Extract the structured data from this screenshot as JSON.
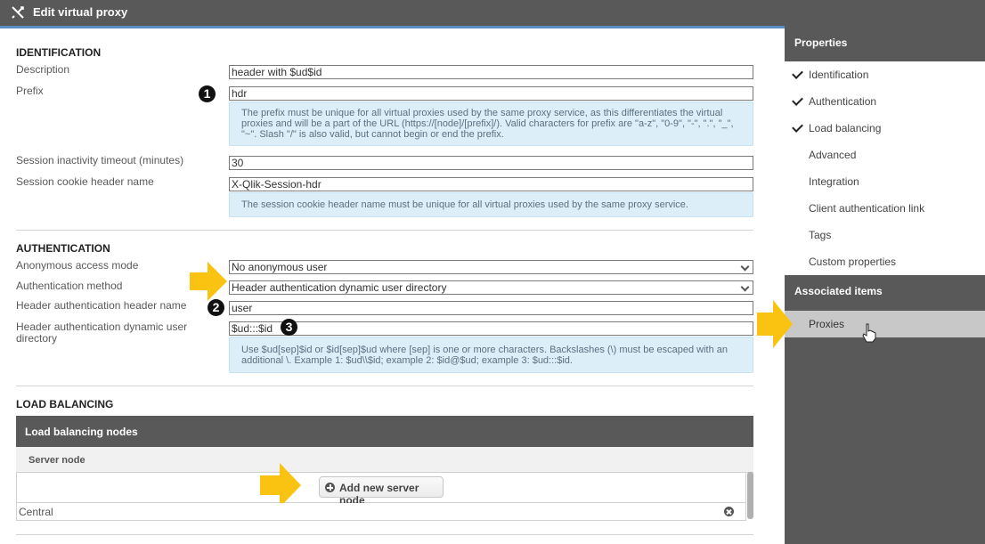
{
  "header": {
    "title": "Edit virtual proxy",
    "icon": "tools-icon"
  },
  "identification": {
    "title": "IDENTIFICATION",
    "description": {
      "label": "Description",
      "value": "header with $ud$id"
    },
    "prefix": {
      "label": "Prefix",
      "value": "hdr",
      "badge": "1",
      "help": "The prefix must be unique for all virtual proxies used by the same proxy service, as this differentiates the virtual proxies and will be a part of the URL (https://[node]/[prefix]/). Valid characters for prefix are \"a-z\", \"0-9\", \"-\", \".\", \"_\", \"~\". Slash \"/\" is also valid, but cannot begin or end the prefix."
    },
    "timeout": {
      "label": "Session inactivity timeout (minutes)",
      "value": "30"
    },
    "cookie": {
      "label": "Session cookie header name",
      "value": "X-Qlik-Session-hdr",
      "help": "The session cookie header name must be unique for all virtual proxies used by the same proxy service."
    }
  },
  "authentication": {
    "title": "AUTHENTICATION",
    "anonymous": {
      "label": "Anonymous access mode",
      "value": "No anonymous user"
    },
    "method": {
      "label": "Authentication method",
      "value": "Header authentication dynamic user directory"
    },
    "header_name": {
      "label": "Header authentication header name",
      "value": "user",
      "badge": "2"
    },
    "dynamic_dir": {
      "label": "Header authentication dynamic user directory",
      "value": "$ud:::$id",
      "badge": "3",
      "help": "Use $ud[sep]$id or $id[sep]$ud where [sep] is one or more characters. Backslashes (\\) must be escaped with an additional \\. Example 1: $ud\\\\$id; example 2: $id@$ud; example 3: $ud:::$id."
    }
  },
  "load_balancing": {
    "title": "LOAD BALANCING",
    "panel_title": "Load balancing nodes",
    "column": "Server node",
    "add_button": "Add new server node",
    "rows": [
      "Central"
    ]
  },
  "sidebar": {
    "properties_title": "Properties",
    "items": [
      {
        "label": "Identification",
        "checked": true
      },
      {
        "label": "Authentication",
        "checked": true
      },
      {
        "label": "Load balancing",
        "checked": true
      },
      {
        "label": "Advanced",
        "checked": false
      },
      {
        "label": "Integration",
        "checked": false
      },
      {
        "label": "Client authentication link",
        "checked": false
      },
      {
        "label": "Tags",
        "checked": false
      },
      {
        "label": "Custom properties",
        "checked": false
      }
    ],
    "associated_title": "Associated items",
    "associated_items": [
      {
        "label": "Proxies",
        "selected": true
      }
    ]
  },
  "colors": {
    "accent": "#5b8ec4",
    "header_bg": "#595959",
    "help_bg": "#dceef7",
    "arrow": "#fbc311"
  }
}
